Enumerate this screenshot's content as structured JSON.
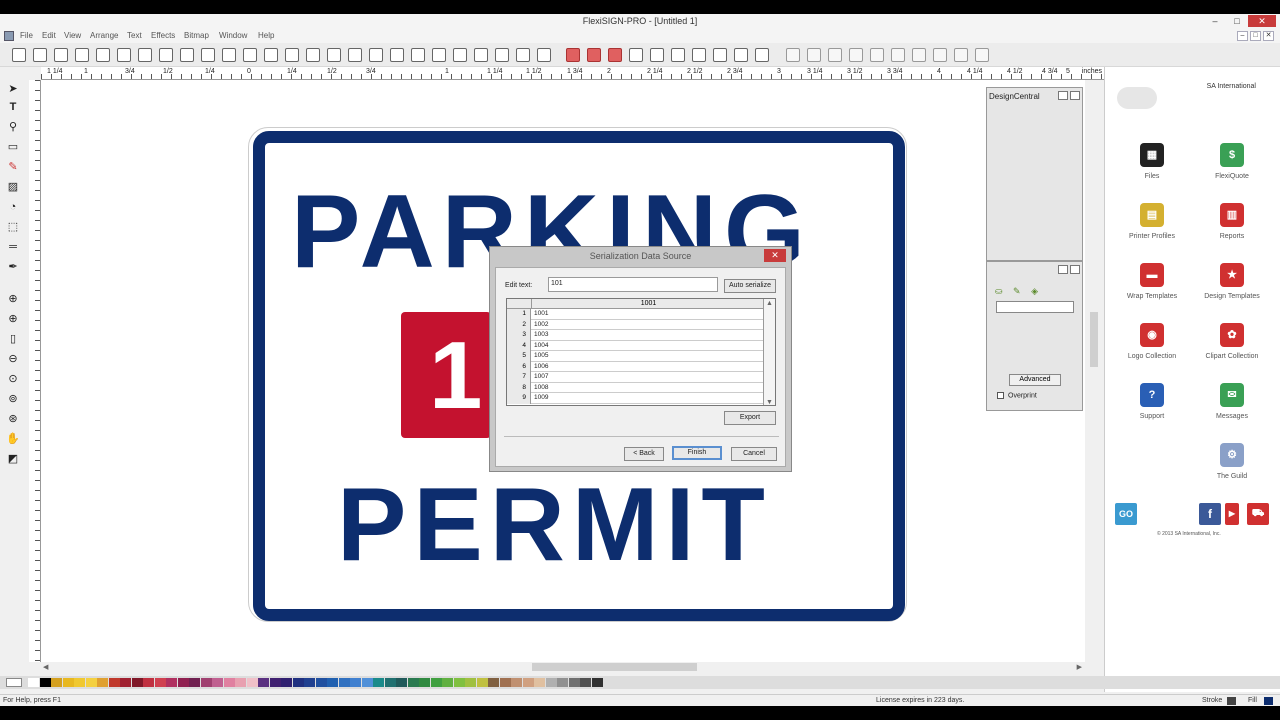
{
  "window": {
    "title": "FlexiSIGN-PRO - [Untitled 1]"
  },
  "menu": [
    "File",
    "Edit",
    "View",
    "Arrange",
    "Text",
    "Effects",
    "Bitmap",
    "Window",
    "Help"
  ],
  "ruler": {
    "top_labels": [
      "1 1/4",
      "1",
      "3/4",
      "1/2",
      "1/4",
      "0",
      "1/4",
      "1/2",
      "3/4",
      "1",
      "1 1/4",
      "1 1/2",
      "1 3/4",
      "2",
      "2 1/4",
      "2 1/2",
      "2 3/4",
      "3",
      "3 1/4",
      "3 1/2",
      "3 3/4",
      "4",
      "4 1/4",
      "4 1/2",
      "4 3/4",
      "5"
    ],
    "unit": "inches"
  },
  "sign": {
    "line1": "PARKING",
    "number": "1",
    "line2": "PERMIT",
    "colors": {
      "navy": "#0d2d6e",
      "red": "#c4122f"
    }
  },
  "dialog": {
    "title": "Serialization Data Source",
    "close": "✕",
    "edit_label": "Edit text:",
    "edit_value": "101",
    "auto_button": "Auto serialize",
    "column_header": "1001",
    "rows": [
      {
        "n": "1",
        "v": "1001"
      },
      {
        "n": "2",
        "v": "1002"
      },
      {
        "n": "3",
        "v": "1003"
      },
      {
        "n": "4",
        "v": "1004"
      },
      {
        "n": "5",
        "v": "1005"
      },
      {
        "n": "6",
        "v": "1006"
      },
      {
        "n": "7",
        "v": "1007"
      },
      {
        "n": "8",
        "v": "1008"
      },
      {
        "n": "9",
        "v": "1009"
      }
    ],
    "export_button": "Export",
    "back_button": "< Back",
    "finish_button": "Finish",
    "cancel_button": "Cancel"
  },
  "design_central": {
    "title": "DesignCentral"
  },
  "fill_panel": {
    "advanced": "Advanced",
    "overprint": "Overprint"
  },
  "home": {
    "brand": "SA International",
    "items": [
      {
        "label": "Files",
        "icon": "files-icon",
        "color": "#222222",
        "glyph": "▦"
      },
      {
        "label": "FlexiQuote",
        "icon": "flexiquote-icon",
        "color": "#3aa055",
        "glyph": "$"
      },
      {
        "label": "Printer Profiles",
        "icon": "printer-profiles-icon",
        "color": "#d4b030",
        "glyph": "▤"
      },
      {
        "label": "Reports",
        "icon": "reports-icon",
        "color": "#d03030",
        "glyph": "▥"
      },
      {
        "label": "Wrap Templates",
        "icon": "wrap-templates-icon",
        "color": "#d03030",
        "glyph": "▬"
      },
      {
        "label": "Design Templates",
        "icon": "design-templates-icon",
        "color": "#d03030",
        "glyph": "★"
      },
      {
        "label": "Logo Collection",
        "icon": "logo-collection-icon",
        "color": "#d03030",
        "glyph": "◉"
      },
      {
        "label": "Clipart Collection",
        "icon": "clipart-collection-icon",
        "color": "#d03030",
        "glyph": "✿"
      },
      {
        "label": "Support",
        "icon": "support-icon",
        "color": "#2a5fb5",
        "glyph": "?"
      },
      {
        "label": "Messages",
        "icon": "messages-icon",
        "color": "#3aa055",
        "glyph": "✉"
      },
      {
        "label": "The Guild",
        "icon": "guild-icon",
        "color": "#8aa0c8",
        "glyph": "⚙"
      }
    ],
    "copyright": "© 2013 SA International, Inc."
  },
  "status": {
    "help": "For Help, press F1",
    "license": "License expires in 223 days.",
    "stroke": "Stroke",
    "fill": "Fill"
  },
  "palette": [
    "#ffffff",
    "#000000",
    "#d4a020",
    "#e8b820",
    "#f0c830",
    "#f4d040",
    "#e0a030",
    "#c0392b",
    "#a02030",
    "#801828",
    "#c03040",
    "#d04050",
    "#b03060",
    "#902050",
    "#702050",
    "#a04070",
    "#c06090",
    "#e080a0",
    "#e8a0b0",
    "#f0c0c8",
    "#5a3080",
    "#402070",
    "#302070",
    "#203080",
    "#204090",
    "#2050a0",
    "#2060b0",
    "#3070c0",
    "#4080d0",
    "#5090d8",
    "#1a8a8a",
    "#207070",
    "#205a5a",
    "#2a7a50",
    "#308a40",
    "#40a040",
    "#60b040",
    "#80c040",
    "#a0c040",
    "#c0c040",
    "#806040",
    "#a07050",
    "#c09070",
    "#d0a080",
    "#e0c0a0",
    "#b0b0b0",
    "#909090",
    "#707070",
    "#505050",
    "#303030"
  ]
}
